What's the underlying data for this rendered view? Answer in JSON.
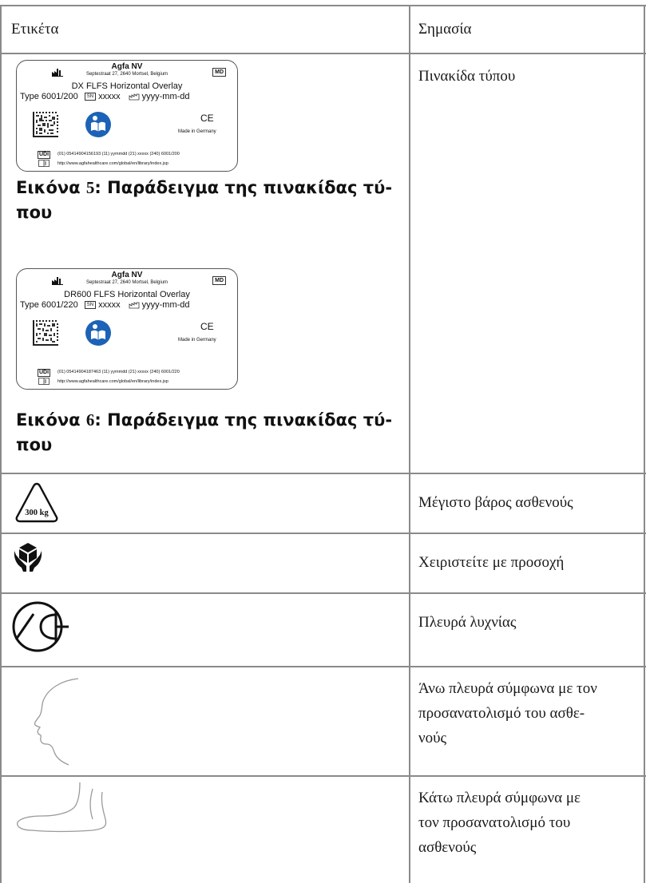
{
  "table": {
    "header": {
      "col1": "Ετικέτα",
      "col2": "Σημασία"
    },
    "rows": [
      {
        "meaning": "Πινακίδα τύπου",
        "plates": [
          {
            "company": "Agfa NV",
            "address": "Septestraat 27, 2640 Mortsel, Belgium",
            "md": "MD",
            "product": "DX FLFS Horizontal Overlay",
            "type": "Type 6001/200",
            "sn_label": "SN",
            "serial": "xxxxx",
            "date": "yyyy-mm-dd",
            "ce": "CE",
            "made_in": "Made in Germany",
            "udi_label": "UDI",
            "udi": "(01) 05414904156193 (11) yymmdd (21) xxxxx (240) 6001/200",
            "url": "http://www.agfahealthcare.com/global/en/library/index.jsp",
            "caption_prefix": "Εικόνα",
            "caption_number": "5",
            "caption_text": ": Παράδειγμα της πινακίδας τύ-",
            "caption_text2": "που"
          },
          {
            "company": "Agfa NV",
            "address": "Septestraat 27, 2640 Mortsel, Belgium",
            "md": "MD",
            "product": "DR600 FLFS Horizontal Overlay",
            "type": "Type 6001/220",
            "sn_label": "SN",
            "serial": "xxxxx",
            "date": "yyyy-mm-dd",
            "ce": "CE",
            "made_in": "Made in Germany",
            "udi_label": "UDI",
            "udi": "(01) 05414904187463 (11) yymmdd (21) xxxxx (240) 6001/220",
            "url": "http://www.agfahealthcare.com/global/en/library/index.jsp",
            "caption_prefix": "Εικόνα",
            "caption_number": "6",
            "caption_text": ": Παράδειγμα της πινακίδας τύ-",
            "caption_text2": "που"
          }
        ]
      },
      {
        "meaning": "Μέγιστο βάρος ασθενούς",
        "icon": "max-patient-weight-icon",
        "icon_text": "300 kg"
      },
      {
        "meaning": "Χειριστείτε με προσοχή",
        "icon": "handle-with-care-icon"
      },
      {
        "meaning": "Πλευρά λυχνίας",
        "icon": "tube-side-icon"
      },
      {
        "meaning_lines": [
          "Άνω πλευρά σύμφωνα με τον",
          "προσανατολισμό του ασθε-",
          "νούς"
        ],
        "icon": "head-profile-icon"
      },
      {
        "meaning_lines": [
          "Κάτω πλευρά σύμφωνα με",
          "τον προσανατολισμό του",
          "ασθενούς"
        ],
        "icon": "foot-icon"
      }
    ]
  }
}
